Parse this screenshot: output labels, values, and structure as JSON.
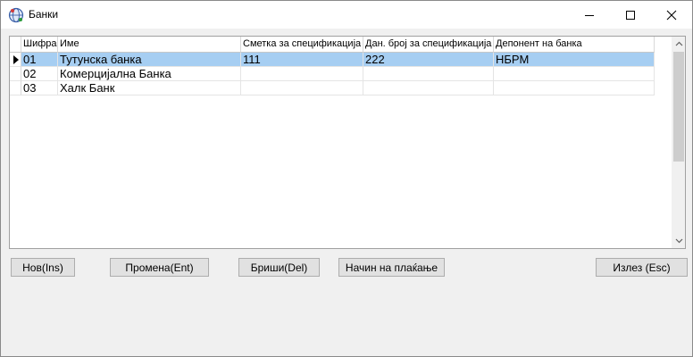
{
  "window": {
    "title": "Банки",
    "icon": "app-globe-icon"
  },
  "grid": {
    "columns": [
      "Шифра",
      "Име",
      "Сметка за спецификација",
      "Дан. број за спецификација",
      "Депонент на банка"
    ],
    "rows": [
      {
        "cells": [
          "01",
          "Тутунска банка",
          "111",
          "222",
          "НБРМ"
        ],
        "selected": true
      },
      {
        "cells": [
          "02",
          "Комерцијална Банка",
          "",
          "",
          ""
        ],
        "selected": false
      },
      {
        "cells": [
          "03",
          "Халк Банк",
          "",
          "",
          ""
        ],
        "selected": false
      }
    ],
    "selected_color": "#a6cef2"
  },
  "buttons": {
    "new": "Нов(Ins)",
    "edit": "Промена(Ent)",
    "delete": "Бриши(Del)",
    "payment": "Начин на плаќање",
    "exit": "Излез (Esc)"
  }
}
